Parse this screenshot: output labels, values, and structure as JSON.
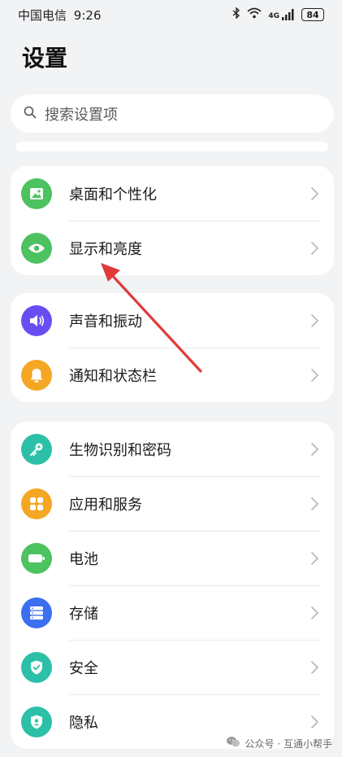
{
  "status_bar": {
    "carrier": "中国电信",
    "time": "9:26",
    "network": "4G",
    "battery": "84"
  },
  "title": "设置",
  "search": {
    "placeholder": "搜索设置项"
  },
  "groups": [
    {
      "items": [
        {
          "label": "桌面和个性化",
          "icon": "image-icon",
          "color": "#4cc260"
        },
        {
          "label": "显示和亮度",
          "icon": "eye-icon",
          "color": "#4cc260"
        }
      ]
    },
    {
      "items": [
        {
          "label": "声音和振动",
          "icon": "speaker-icon",
          "color": "#6a4df2"
        },
        {
          "label": "通知和状态栏",
          "icon": "bell-icon",
          "color": "#f5a623"
        }
      ]
    },
    {
      "items": [
        {
          "label": "生物识别和密码",
          "icon": "key-icon",
          "color": "#2cc0a8"
        },
        {
          "label": "应用和服务",
          "icon": "apps-icon",
          "color": "#f5a623"
        },
        {
          "label": "电池",
          "icon": "battery-icon",
          "color": "#4cc260"
        },
        {
          "label": "存储",
          "icon": "storage-icon",
          "color": "#3b6ef0"
        },
        {
          "label": "安全",
          "icon": "shield-check-icon",
          "color": "#2cc0a8"
        },
        {
          "label": "隐私",
          "icon": "privacy-shield-icon",
          "color": "#2cc0a8"
        }
      ]
    }
  ],
  "annotation": {
    "color": "#e03b3b"
  },
  "watermark": "公众号 · 互通小帮手"
}
